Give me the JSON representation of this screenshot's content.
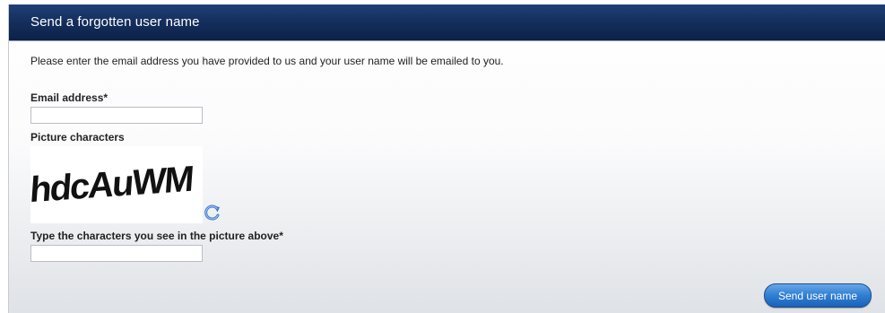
{
  "header": {
    "title": "Send a forgotten user name"
  },
  "intro_text": "Please enter the email address you have provided to us and your user name will be emailed to you.",
  "email": {
    "label": "Email address*",
    "value": "",
    "placeholder": ""
  },
  "captcha": {
    "label": "Picture characters",
    "image_text": "hdcAuWM",
    "refresh_icon": "refresh-icon"
  },
  "captcha_answer": {
    "label": "Type the characters you see in the picture above*",
    "value": "",
    "placeholder": ""
  },
  "submit": {
    "label": "Send user name"
  },
  "colors": {
    "header": "#15305f",
    "button": "#2f7ed2",
    "refresh": "#3a78d0"
  }
}
